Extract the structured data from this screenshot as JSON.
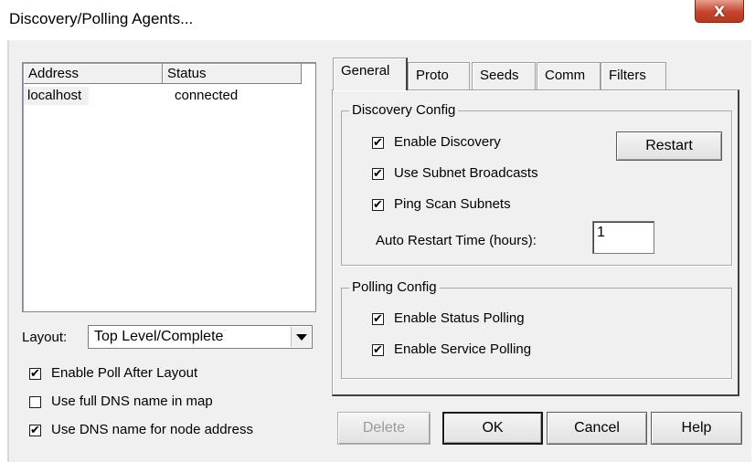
{
  "window": {
    "title": "Discovery/Polling Agents...",
    "close_glyph": "X"
  },
  "agents_list": {
    "columns": [
      "Address",
      "Status"
    ],
    "rows": [
      {
        "address": "localhost",
        "status": "connected"
      }
    ]
  },
  "layout": {
    "label": "Layout:",
    "selected": "Top Level/Complete"
  },
  "left_options": {
    "enable_poll_after_layout": {
      "label": "Enable Poll After Layout",
      "checked": true
    },
    "use_full_dns": {
      "label": "Use full DNS name in map",
      "checked": false
    },
    "use_dns_node_address": {
      "label": "Use DNS name for node address",
      "checked": true
    }
  },
  "tabs": [
    "General",
    "Proto",
    "Seeds",
    "Comm",
    "Filters"
  ],
  "active_tab": "General",
  "discovery_config": {
    "title": "Discovery Config",
    "enable_discovery": {
      "label": "Enable Discovery",
      "checked": true
    },
    "use_subnet_broadcasts": {
      "label": "Use Subnet Broadcasts",
      "checked": true
    },
    "ping_scan_subnets": {
      "label": "Ping Scan Subnets",
      "checked": true
    },
    "restart_button": "Restart",
    "auto_restart_label": "Auto Restart Time (hours):",
    "auto_restart_value": "1"
  },
  "polling_config": {
    "title": "Polling Config",
    "enable_status_polling": {
      "label": "Enable Status Polling",
      "checked": true
    },
    "enable_service_polling": {
      "label": "Enable Service Polling",
      "checked": true
    }
  },
  "buttons": {
    "delete": "Delete",
    "ok": "OK",
    "cancel": "Cancel",
    "help": "Help"
  },
  "check_glyph": "✔"
}
